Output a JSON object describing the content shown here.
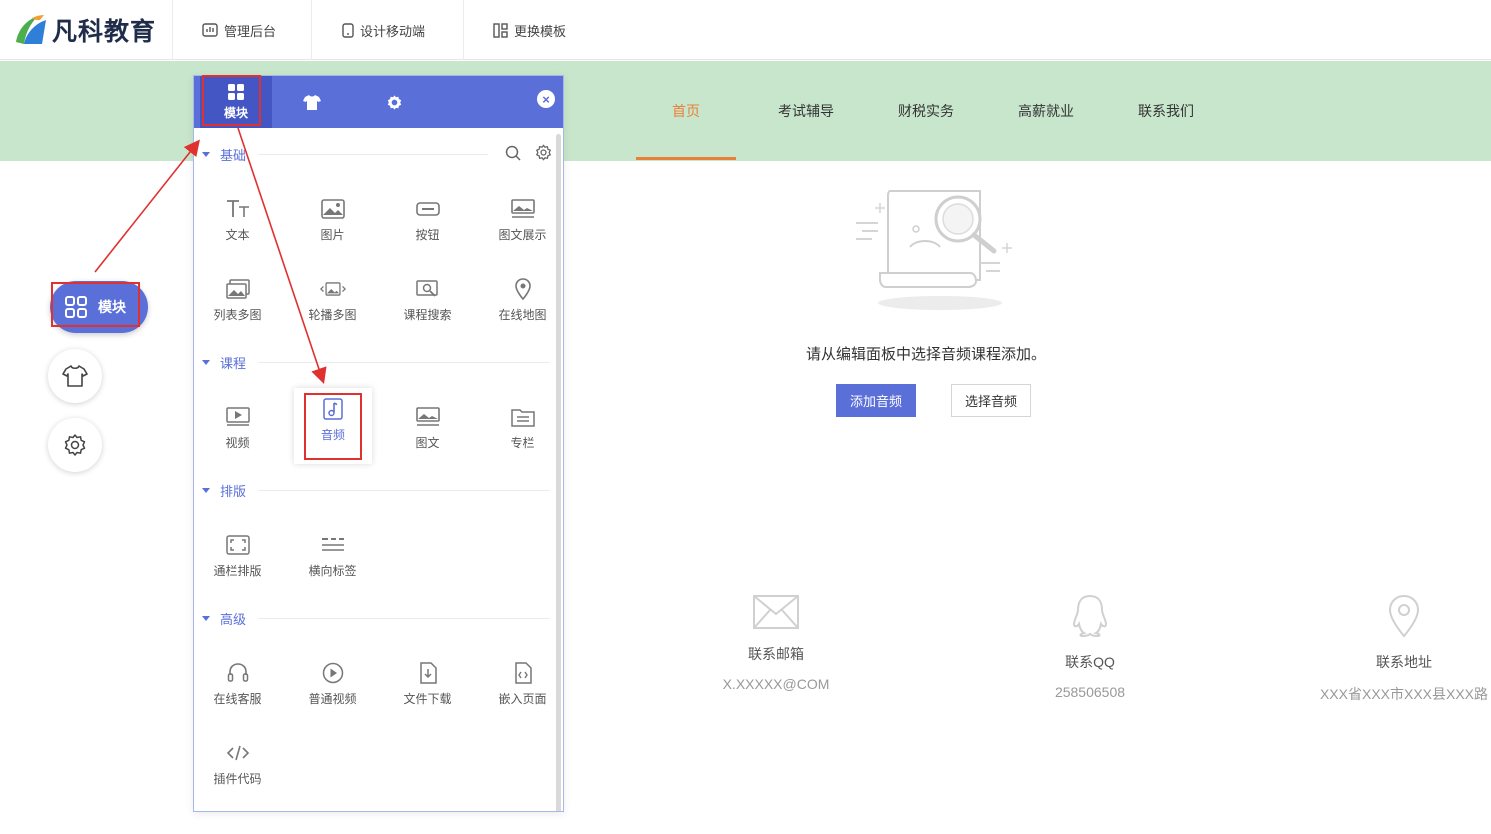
{
  "brand": {
    "name": "凡科教育",
    "colors": {
      "blue": "#2f7fd8",
      "green": "#4cae4c",
      "orange": "#e8803a"
    }
  },
  "topbar": {
    "links": [
      {
        "label": "管理后台",
        "icon": "dashboard-icon"
      },
      {
        "label": "设计移动端",
        "icon": "mobile-icon"
      },
      {
        "label": "更换模板",
        "icon": "template-icon"
      }
    ]
  },
  "nav": {
    "items": [
      "首页",
      "考试辅导",
      "财税实务",
      "高薪就业",
      "联系我们"
    ],
    "active_index": 0,
    "background": "#c8e6cc",
    "accent": "#e8803a"
  },
  "side": {
    "module_label": "模块"
  },
  "panel": {
    "tabs": [
      {
        "label": "模块",
        "icon": "grid-icon"
      },
      {
        "label": "",
        "icon": "shirt-icon"
      },
      {
        "label": "",
        "icon": "gear-icon"
      }
    ],
    "close": "×",
    "accent": "#5b6fd9",
    "sections": [
      {
        "title": "基础",
        "items": [
          "文本",
          "图片",
          "按钮",
          "图文展示",
          "列表多图",
          "轮播多图",
          "课程搜索",
          "在线地图"
        ]
      },
      {
        "title": "课程",
        "items": [
          "视频",
          "音频",
          "图文",
          "专栏"
        ],
        "selected": "音频"
      },
      {
        "title": "排版",
        "items": [
          "通栏排版",
          "横向标签"
        ]
      },
      {
        "title": "高级",
        "items": [
          "在线客服",
          "普通视频",
          "文件下载",
          "嵌入页面",
          "插件代码"
        ]
      }
    ]
  },
  "main": {
    "empty_message": "请从编辑面板中选择音频课程添加。",
    "add_button": "添加音频",
    "select_button": "选择音频"
  },
  "contacts": [
    {
      "label": "联系邮箱",
      "value": "X.XXXXX@COM",
      "icon": "mail-icon"
    },
    {
      "label": "联系QQ",
      "value": "258506508",
      "icon": "qq-icon"
    },
    {
      "label": "联系地址",
      "value": "XXX省XXX市XXX县XXX路",
      "icon": "location-icon"
    }
  ]
}
